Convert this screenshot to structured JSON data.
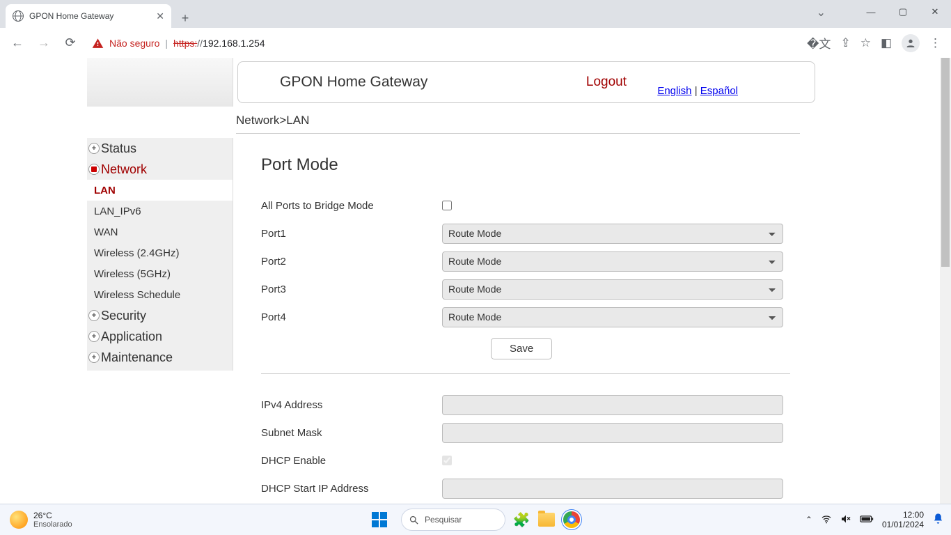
{
  "browser": {
    "tab_title": "GPON Home Gateway",
    "not_secure_label": "Não seguro",
    "url_protocol": "https:",
    "url_rest": "//",
    "url_host": "192.168.1.254"
  },
  "header": {
    "title": "GPON Home Gateway",
    "logout": "Logout",
    "lang_en": "English",
    "lang_es": "Español"
  },
  "breadcrumb": "Network>LAN",
  "sidebar": {
    "status": "Status",
    "network": "Network",
    "subs": {
      "lan": "LAN",
      "lan_ipv6": "LAN_IPv6",
      "wan": "WAN",
      "w24": "Wireless (2.4GHz)",
      "w5": "Wireless (5GHz)",
      "ws": "Wireless Schedule"
    },
    "security": "Security",
    "application": "Application",
    "maintenance": "Maintenance"
  },
  "content": {
    "portmode_h": "Port Mode",
    "all_bridge": "All Ports to Bridge Mode",
    "port1": "Port1",
    "port2": "Port2",
    "port3": "Port3",
    "port4": "Port4",
    "route_mode": "Route Mode",
    "save": "Save",
    "ipv4_addr": "IPv4 Address",
    "subnet": "Subnet Mask",
    "dhcp_en": "DHCP Enable",
    "dhcp_start": "DHCP Start IP Address"
  },
  "taskbar": {
    "temp": "26°C",
    "cond": "Ensolarado",
    "search_ph": "Pesquisar",
    "time": "12:00",
    "date": "01/01/2024"
  }
}
